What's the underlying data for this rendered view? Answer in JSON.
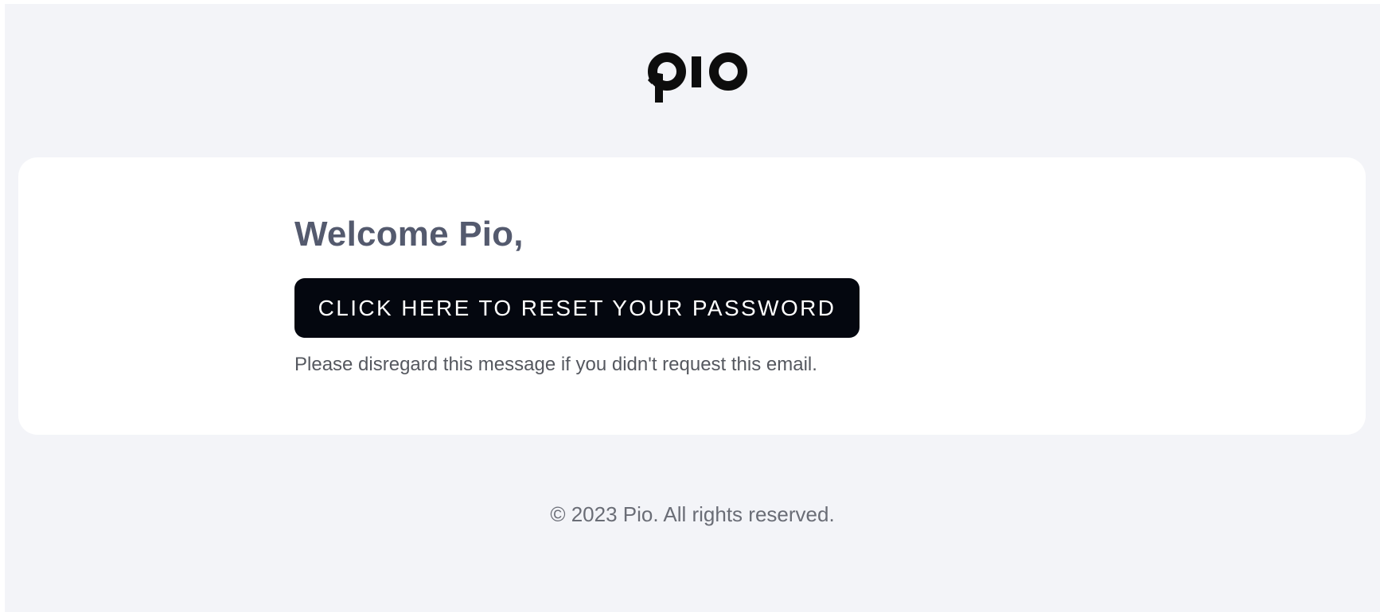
{
  "header": {
    "logo_text": "pio"
  },
  "card": {
    "greeting": "Welcome Pio,",
    "reset_button_label": "CLICK HERE TO RESET YOUR PASSWORD",
    "note": "Please disregard this message if you didn't request this email."
  },
  "footer": {
    "copyright": "© 2023 Pio. All rights reserved."
  },
  "colors": {
    "page_background": "#f3f4f8",
    "card_background": "#ffffff",
    "button_background": "#04070f",
    "greeting_text": "#545a6e"
  }
}
